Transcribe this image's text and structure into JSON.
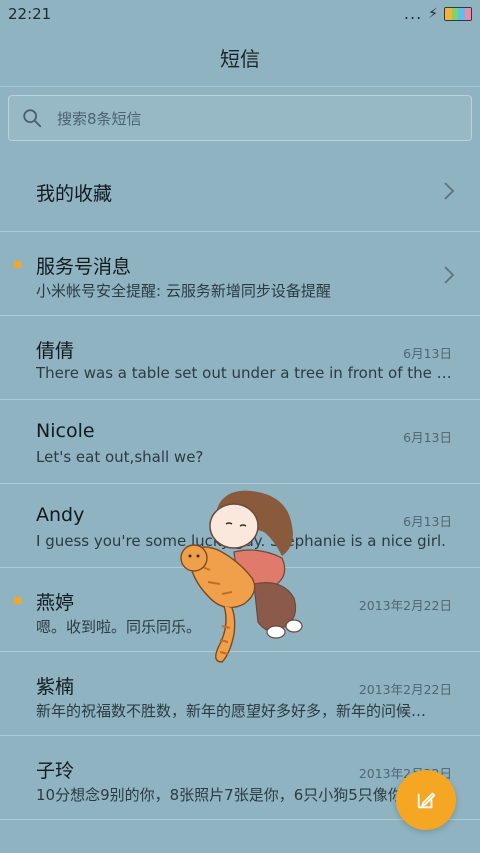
{
  "status_bar": {
    "time": "22:21",
    "signal": "..."
  },
  "header": {
    "title": "短信"
  },
  "search": {
    "placeholder": "搜索8条短信"
  },
  "conversations": [
    {
      "name": "我的收藏",
      "preview": "",
      "date": "",
      "unread": false,
      "chevron": true
    },
    {
      "name": "服务号消息",
      "preview": "小米帐号安全提醒: 云服务新增同步设备提醒",
      "date": "",
      "unread": true,
      "chevron": true
    },
    {
      "name": "倩倩",
      "preview": "There was a table set out under a tree in front of the ho…",
      "date": "6月13日",
      "unread": false,
      "chevron": false
    },
    {
      "name": "Nicole",
      "preview": "Let's eat out,shall we?",
      "date": "6月13日",
      "unread": false,
      "chevron": false
    },
    {
      "name": "Andy",
      "preview": "I guess you're some lucky guy. Stephanie is a nice girl.",
      "date": "6月13日",
      "unread": false,
      "chevron": false
    },
    {
      "name": "燕婷",
      "preview": "嗯。收到啦。同乐同乐。",
      "date": "2013年2月22日",
      "unread": true,
      "chevron": false
    },
    {
      "name": "紫楠",
      "preview": "新年的祝福数不胜数，新年的愿望好多好多，新年的问候…",
      "date": "2013年2月22日",
      "unread": false,
      "chevron": false
    },
    {
      "name": "子玲",
      "preview": "10分想念9别的你，8张照片7张是你，6只小狗5只像你…",
      "date": "2013年2月22日",
      "unread": false,
      "chevron": false
    }
  ],
  "colors": {
    "accent": "#f5a623",
    "background": "#8fb3c1"
  }
}
